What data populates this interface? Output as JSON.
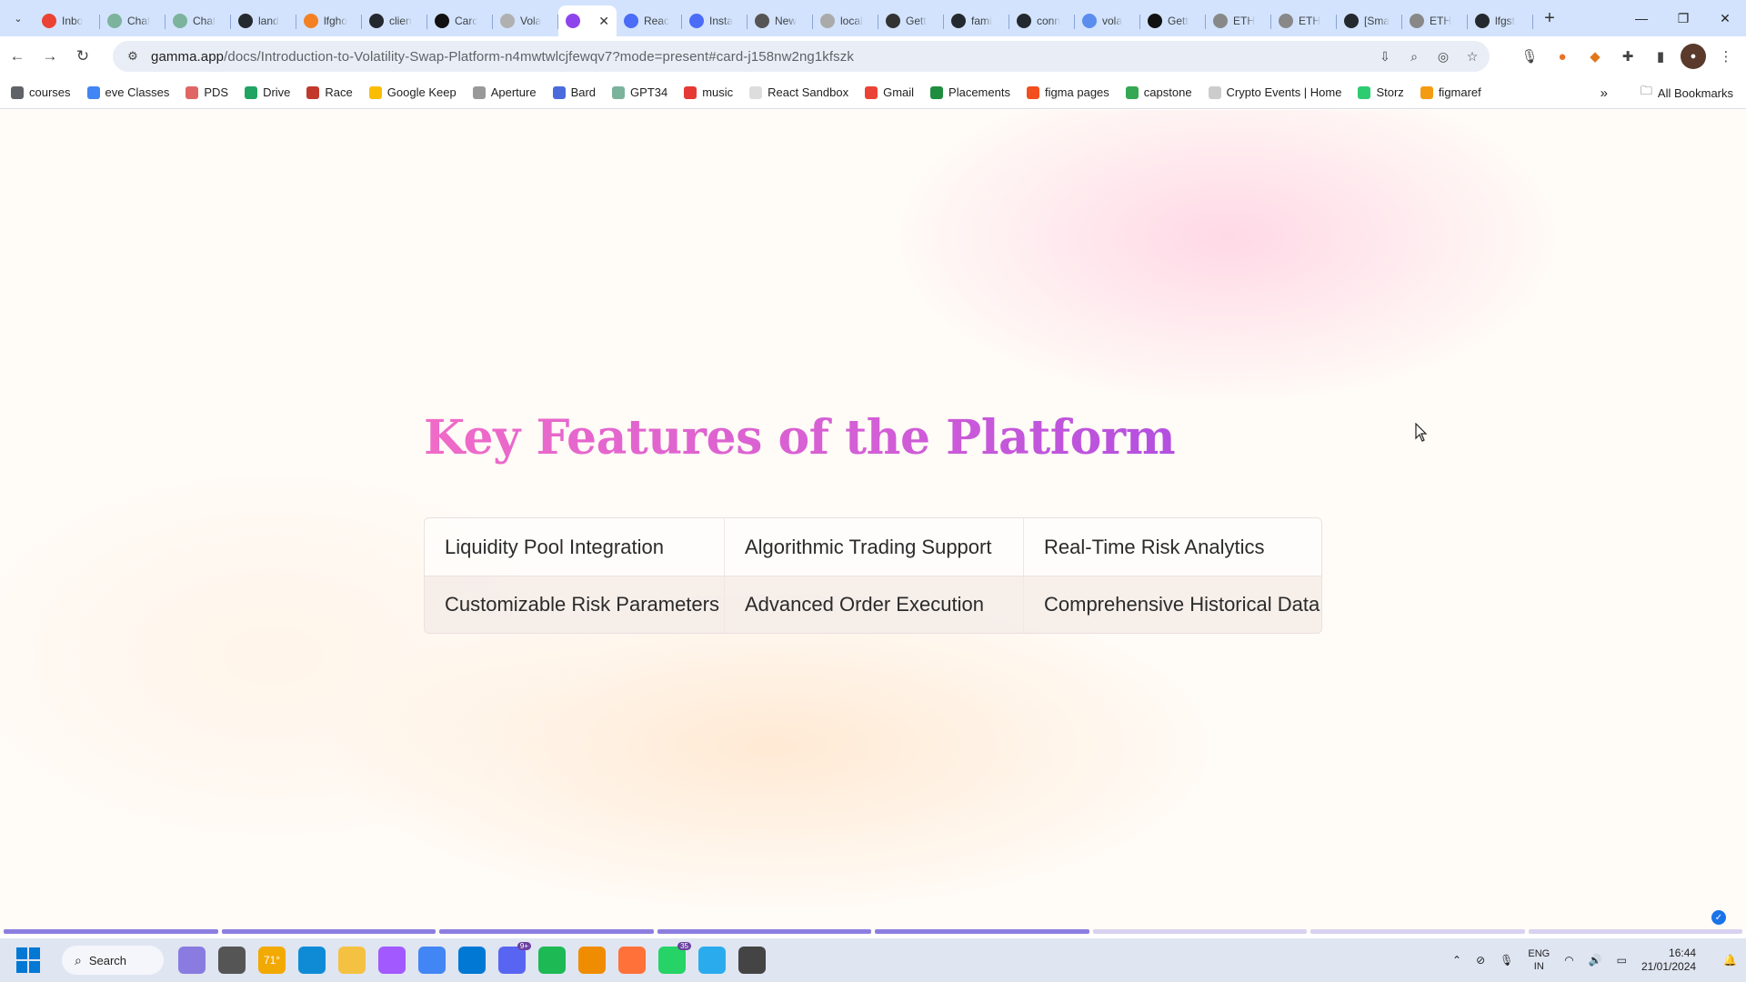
{
  "browser": {
    "tabs": [
      {
        "title": "Inbo",
        "color": "#ea4335"
      },
      {
        "title": "Chat",
        "color": "#7bb39d"
      },
      {
        "title": "Chat",
        "color": "#7bb39d"
      },
      {
        "title": "land",
        "color": "#24292f"
      },
      {
        "title": "lfgho",
        "color": "#f48024"
      },
      {
        "title": "clien",
        "color": "#24292f"
      },
      {
        "title": "Carc",
        "color": "#111111"
      },
      {
        "title": "Vola",
        "color": "#b0b0b0"
      },
      {
        "title": "",
        "color": "#8e44ec",
        "active": true
      },
      {
        "title": "Reac",
        "color": "#4a6cf7"
      },
      {
        "title": "Insta",
        "color": "#4a6cf7"
      },
      {
        "title": "New",
        "color": "#555555"
      },
      {
        "title": "local",
        "color": "#aaaaaa"
      },
      {
        "title": "Gett",
        "color": "#333333"
      },
      {
        "title": "fami",
        "color": "#24292f"
      },
      {
        "title": "conn",
        "color": "#24292f"
      },
      {
        "title": "vola",
        "color": "#5b8def"
      },
      {
        "title": "Gett",
        "color": "#111111"
      },
      {
        "title": "ETH",
        "color": "#888888"
      },
      {
        "title": "ETH",
        "color": "#888888"
      },
      {
        "title": "[Sma",
        "color": "#24292f"
      },
      {
        "title": "ETH",
        "color": "#888888"
      },
      {
        "title": "lfgst",
        "color": "#24292f"
      }
    ],
    "url_host": "gamma.app",
    "url_path": "/docs/Introduction-to-Volatility-Swap-Platform-n4mwtwlcjfewqv7?mode=present#card-j158nw2ng1kfszk",
    "bookmarks": [
      {
        "label": "courses",
        "color": "#5f6368"
      },
      {
        "label": "eve Classes",
        "color": "#4285f4"
      },
      {
        "label": "PDS",
        "color": "#e06666"
      },
      {
        "label": "Drive",
        "color": "#1fa463"
      },
      {
        "label": "Race",
        "color": "#c0392b"
      },
      {
        "label": "Google Keep",
        "color": "#fbbc04"
      },
      {
        "label": "Aperture",
        "color": "#999999"
      },
      {
        "label": "Bard",
        "color": "#4b6bdc"
      },
      {
        "label": "GPT34",
        "color": "#7bb39d"
      },
      {
        "label": "music",
        "color": "#e53935"
      },
      {
        "label": "React Sandbox",
        "color": "#dddddd"
      },
      {
        "label": "Gmail",
        "color": "#ea4335"
      },
      {
        "label": "Placements",
        "color": "#1e8e3e"
      },
      {
        "label": "figma pages",
        "color": "#f24e1e"
      },
      {
        "label": "capstone",
        "color": "#34a853"
      },
      {
        "label": "Crypto Events | Home",
        "color": "#cccccc"
      },
      {
        "label": "Storz",
        "color": "#2ecc71"
      },
      {
        "label": "figmaref",
        "color": "#f39c12"
      }
    ],
    "all_bookmarks": "All Bookmarks"
  },
  "slide": {
    "title": "Key Features of the Platform",
    "features": [
      [
        "Liquidity Pool Integration",
        "Algorithmic Trading Support",
        "Real-Time Risk Analytics"
      ],
      [
        "Customizable Risk Parameters",
        "Advanced Order Execution",
        "Comprehensive Historical Data"
      ]
    ],
    "progress": {
      "total_segments": 8,
      "completed_segments": 5
    }
  },
  "taskbar": {
    "search_label": "Search",
    "apps": [
      {
        "name": "widgets",
        "color": "#8a7be0",
        "label": ""
      },
      {
        "name": "task-view",
        "color": "#555555",
        "label": ""
      },
      {
        "name": "weather",
        "color": "#f2a900",
        "label": "71°"
      },
      {
        "name": "edge",
        "color": "#0f8bd6",
        "label": ""
      },
      {
        "name": "file-explorer",
        "color": "#f4c142",
        "label": ""
      },
      {
        "name": "figma",
        "color": "#a259ff",
        "label": ""
      },
      {
        "name": "chrome",
        "color": "#4285f4",
        "label": ""
      },
      {
        "name": "vscode",
        "color": "#0078d4",
        "label": ""
      },
      {
        "name": "discord",
        "color": "#5865f2",
        "label": "",
        "badge": "9+"
      },
      {
        "name": "spotify",
        "color": "#1db954",
        "label": ""
      },
      {
        "name": "vlc",
        "color": "#f08c00",
        "label": ""
      },
      {
        "name": "firefox",
        "color": "#ff7139",
        "label": ""
      },
      {
        "name": "whatsapp",
        "color": "#25d366",
        "label": "",
        "badge": "35"
      },
      {
        "name": "telegram",
        "color": "#2aabee",
        "label": ""
      },
      {
        "name": "chatgpt",
        "color": "#444444",
        "label": ""
      }
    ],
    "lang": "ENG",
    "region": "IN",
    "time": "16:44",
    "date": "21/01/2024"
  }
}
